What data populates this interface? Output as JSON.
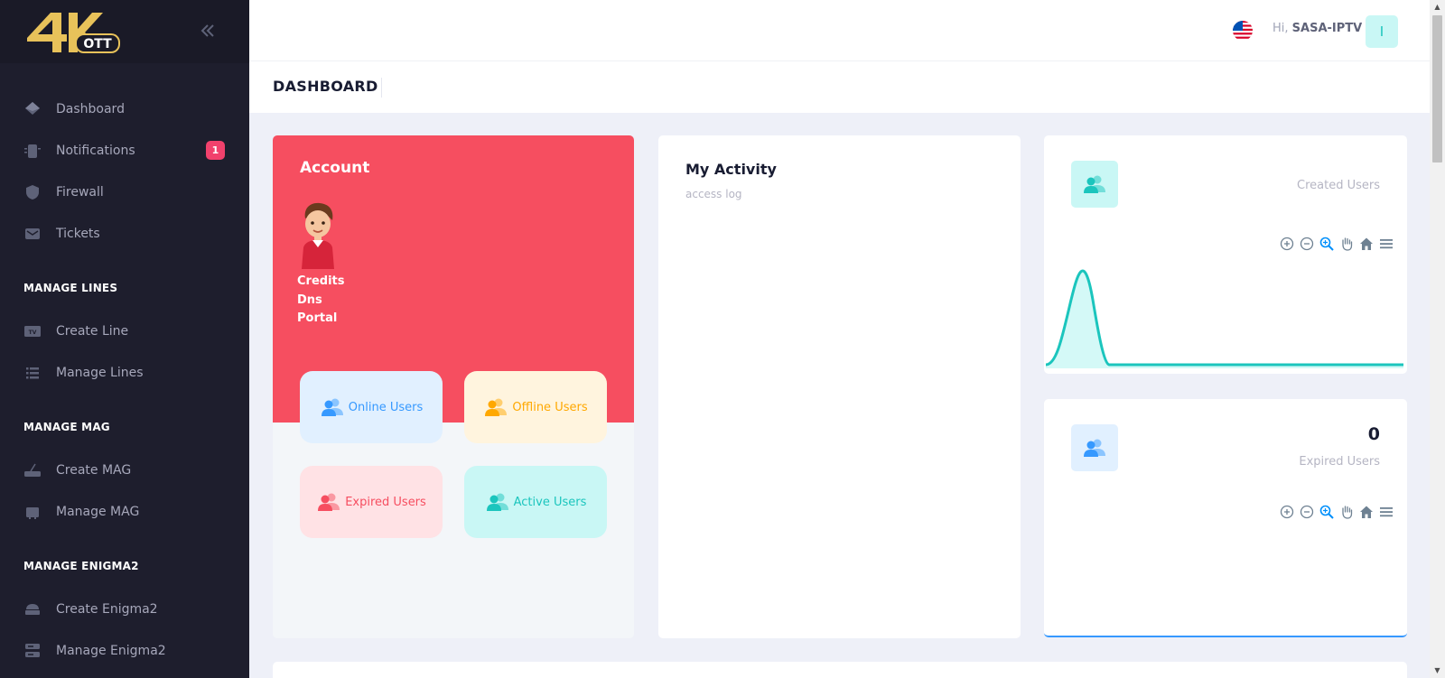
{
  "brand": {
    "logo_text": "OTT",
    "logo_number": "4K"
  },
  "sidebar": {
    "collapse_icon": "double-chevron-left-icon",
    "items": [
      {
        "label": "Dashboard",
        "icon": "dashboard-icon"
      },
      {
        "label": "Notifications",
        "icon": "notifications-icon",
        "badge": "1"
      },
      {
        "label": "Firewall",
        "icon": "shield-icon"
      },
      {
        "label": "Tickets",
        "icon": "envelope-icon"
      }
    ],
    "sections": [
      {
        "title": "MANAGE LINES",
        "items": [
          {
            "label": "Create Line",
            "icon": "tv-icon"
          },
          {
            "label": "Manage Lines",
            "icon": "list-icon"
          }
        ]
      },
      {
        "title": "MANAGE MAG",
        "items": [
          {
            "label": "Create MAG",
            "icon": "router-icon"
          },
          {
            "label": "Manage MAG",
            "icon": "box-icon"
          }
        ]
      },
      {
        "title": "MANAGE ENIGMA2",
        "items": [
          {
            "label": "Create Enigma2",
            "icon": "receiver-icon"
          },
          {
            "label": "Manage Enigma2",
            "icon": "server-icon"
          }
        ]
      }
    ]
  },
  "header": {
    "greeting_prefix": "Hi,",
    "username": "SASA-IPTV",
    "avatar_letter": "I",
    "language_flag": "us-flag-icon"
  },
  "subheader": {
    "page_title": "DASHBOARD"
  },
  "account": {
    "title": "Account",
    "lines": [
      "Credits",
      "Dns",
      "Portal"
    ],
    "tiles": {
      "online": "Online Users",
      "offline": "Offline Users",
      "expired": "Expired Users",
      "active": "Active Users"
    }
  },
  "activity": {
    "title": "My Activity",
    "subtitle": "access log"
  },
  "created_users": {
    "label": "Created Users"
  },
  "expired_users": {
    "value": "0",
    "label": "Expired Users"
  },
  "colors": {
    "sidebar_bg": "#1e1e2d",
    "danger": "#f64e60",
    "primary": "#3699ff",
    "warning": "#ffa800",
    "success": "#1bc5bd"
  }
}
